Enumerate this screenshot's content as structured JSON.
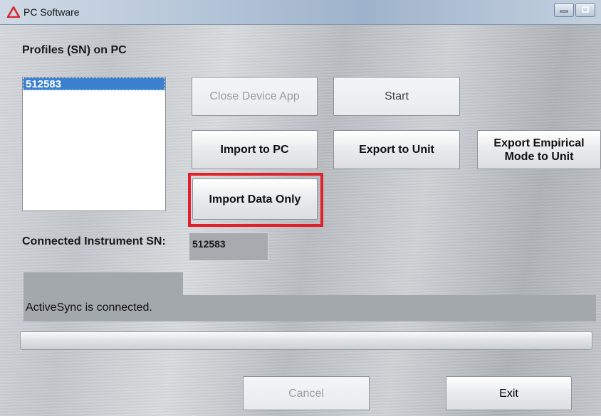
{
  "window": {
    "title": "PC Software",
    "controls": [
      "minimize",
      "maximize"
    ]
  },
  "profiles": {
    "label": "Profiles (SN) on PC",
    "items": [
      "512583"
    ],
    "selected": "512583"
  },
  "buttons": {
    "close_device_app": "Close Device App",
    "start": "Start",
    "import_to_pc": "Import to PC",
    "export_to_unit": "Export to Unit",
    "export_empirical_line1": "Export Empirical",
    "export_empirical_line2": "Mode to Unit",
    "import_data_only": "Import Data Only",
    "cancel": "Cancel",
    "exit": "Exit"
  },
  "connected": {
    "label": "Connected Instrument SN:",
    "value": "512583"
  },
  "status": {
    "message": "ActiveSync is connected."
  },
  "progress": {
    "value": 0
  },
  "colors": {
    "highlight": "#e0202a",
    "selection": "#3a7fd0",
    "app_icon": "#d8262e"
  }
}
